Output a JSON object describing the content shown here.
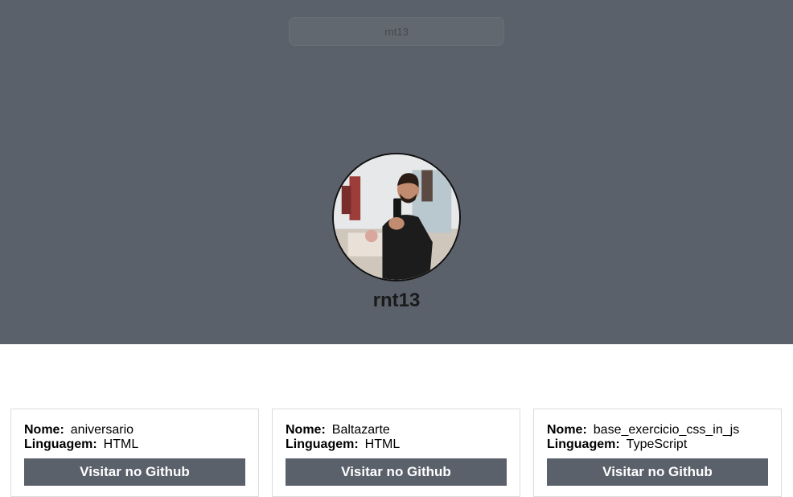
{
  "search": {
    "value": "rnt13"
  },
  "profile": {
    "username": "rnt13"
  },
  "labels": {
    "name": "Nome:",
    "language": "Linguagem:"
  },
  "repos": [
    {
      "name": "aniversario",
      "language": "HTML",
      "button": "Visitar no Github"
    },
    {
      "name": "Baltazarte",
      "language": "HTML",
      "button": "Visitar no Github"
    },
    {
      "name": "base_exercicio_css_in_js",
      "language": "TypeScript",
      "button": "Visitar no Github"
    }
  ],
  "colors": {
    "header_bg": "#5b616b",
    "button_bg": "#5b616b"
  }
}
